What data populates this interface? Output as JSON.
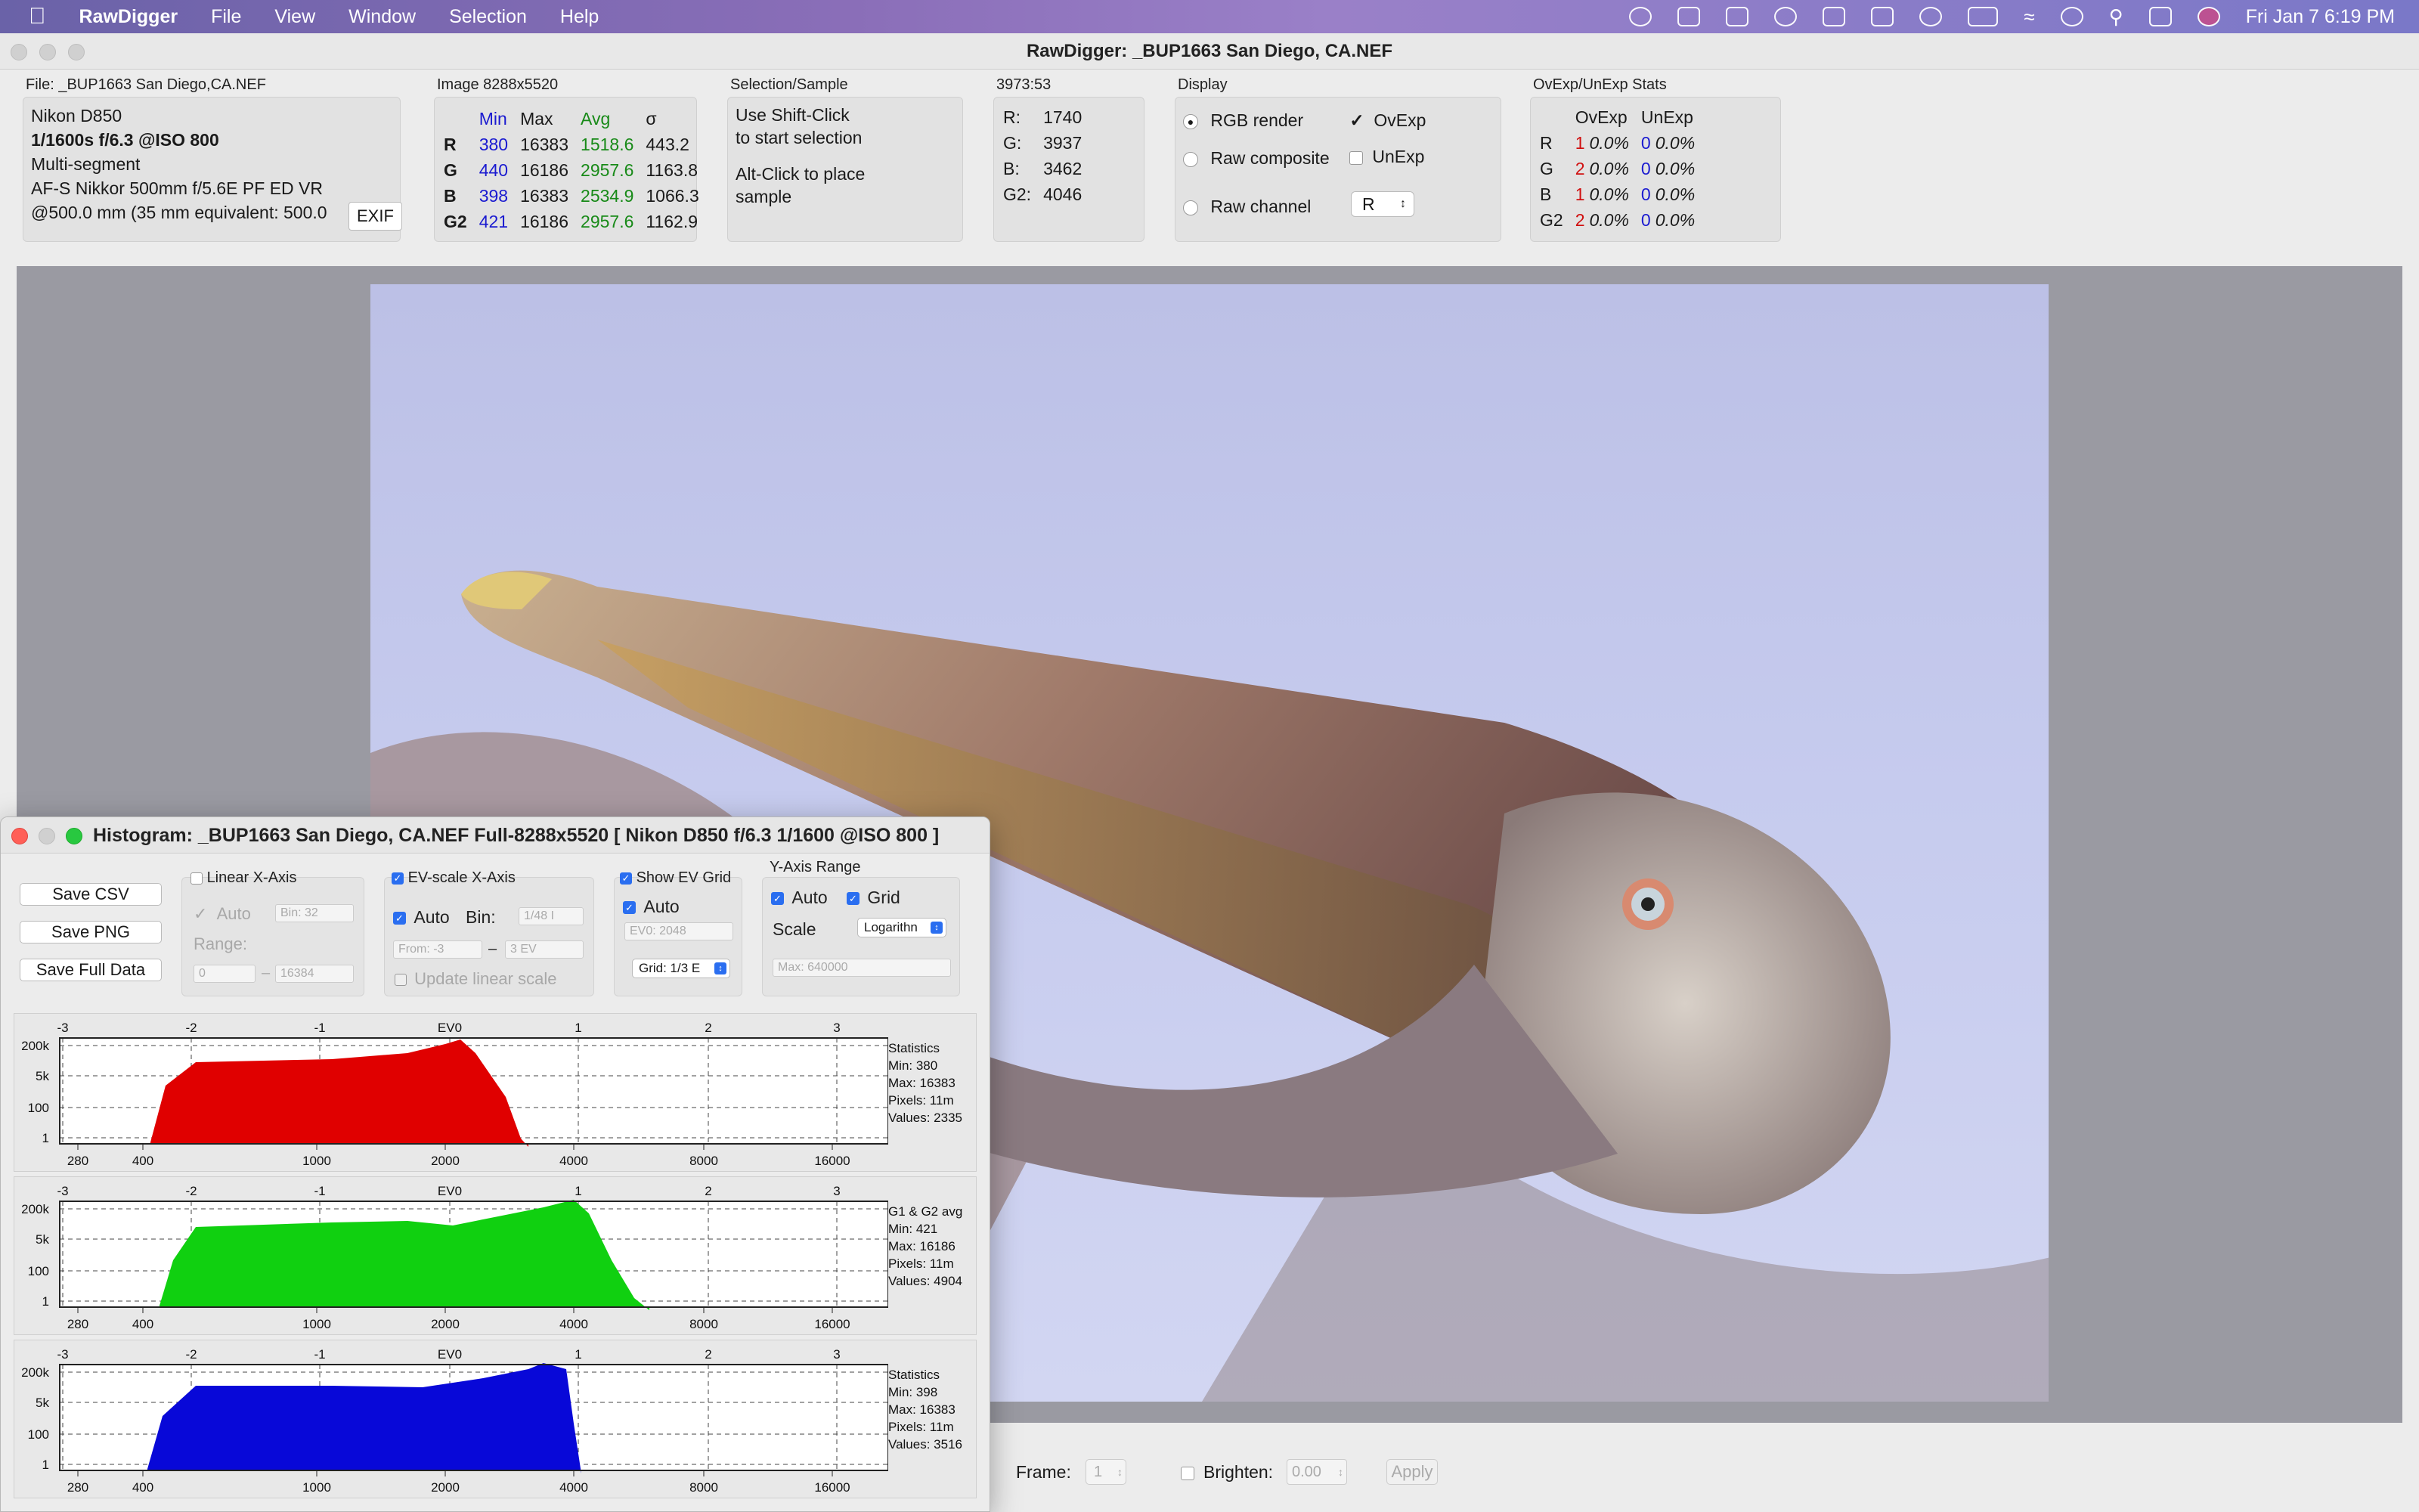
{
  "menubar": {
    "app_name": "RawDigger",
    "items": [
      "File",
      "View",
      "Window",
      "Selection",
      "Help"
    ],
    "clock": "Fri Jan 7  6:19 PM"
  },
  "window": {
    "title": "RawDigger: _BUP1663  San Diego, CA.NEF"
  },
  "file_panel": {
    "title": "File: _BUP1663  San Diego,CA.NEF",
    "camera": "Nikon D850",
    "exposure": "1/1600s f/6.3 @ISO 800",
    "mode": "Multi-segment",
    "lens": "AF-S Nikkor 500mm f/5.6E PF ED VR",
    "focal": "@500.0 mm (35 mm equivalent: 500.0",
    "exif_button": "EXIF"
  },
  "image_panel": {
    "title": "Image 8288x5520",
    "headers": [
      "",
      "Min",
      "Max",
      "Avg",
      "σ"
    ],
    "rows": [
      [
        "R",
        "380",
        "16383",
        "1518.6",
        "443.2"
      ],
      [
        "G",
        "440",
        "16186",
        "2957.6",
        "1163.8"
      ],
      [
        "B",
        "398",
        "16383",
        "2534.9",
        "1066.3"
      ],
      [
        "G2",
        "421",
        "16186",
        "2957.6",
        "1162.9"
      ]
    ]
  },
  "selection_panel": {
    "title": "Selection/Sample",
    "line1": "Use Shift-Click",
    "line2": "to start selection",
    "line3": "Alt-Click to place",
    "line4": "sample"
  },
  "coord_panel": {
    "title": "3973:53",
    "rows": [
      [
        "R:",
        "1740"
      ],
      [
        "G:",
        "3937"
      ],
      [
        "B:",
        "3462"
      ],
      [
        "G2:",
        "4046"
      ]
    ]
  },
  "display_panel": {
    "title": "Display",
    "rgb_render": "RGB render",
    "raw_composite": "Raw composite",
    "raw_channel": "Raw channel",
    "ovexp": "OvExp",
    "unexp": "UnExp",
    "channel_value": "R"
  },
  "stats_panel": {
    "title": "OvExp/UnExp Stats",
    "headers": [
      "",
      "OvExp",
      "",
      "UnExp",
      ""
    ],
    "rows": [
      [
        "R",
        "1",
        "0.0%",
        "0",
        "0.0%"
      ],
      [
        "G",
        "2",
        "0.0%",
        "0",
        "0.0%"
      ],
      [
        "B",
        "1",
        "0.0%",
        "0",
        "0.0%"
      ],
      [
        "G2",
        "2",
        "0.0%",
        "0",
        "0.0%"
      ]
    ]
  },
  "bottom_bar": {
    "frame_label": "Frame:",
    "frame_value": "1",
    "brighten_label": "Brighten:",
    "brighten_value": "0.00",
    "apply_label": "Apply"
  },
  "histogram": {
    "title": "Histogram: _BUP1663  San Diego, CA.NEF Full-8288x5520 [ Nikon D850 f/6.3 1/1600 @ISO 800 ]",
    "buttons": [
      "Save CSV",
      "Save PNG",
      "Save Full Data"
    ],
    "linear_x": {
      "title": "Linear X-Axis",
      "auto": "Auto",
      "bin": "Bin: 32",
      "range": "Range:",
      "from": "0",
      "to": "16384"
    },
    "ev_x": {
      "title": "EV-scale X-Axis",
      "auto": "Auto",
      "bin_label": "Bin:",
      "bin": "1/48 I",
      "from": "From: -3",
      "to": "3 EV",
      "update": "Update linear scale"
    },
    "ev_grid": {
      "title": "Show EV Grid",
      "auto": "Auto",
      "ev0": "EV0: 2048",
      "grid": "Grid: 1/3 E"
    },
    "y_range": {
      "title": "Y-Axis Range",
      "auto": "Auto",
      "grid": "Grid",
      "scale_label": "Scale",
      "scale": "Logarithn",
      "max": "Max: 640000"
    },
    "ev_ticks": [
      "-3",
      "-2",
      "-1",
      "EV0",
      "1",
      "2",
      "3"
    ],
    "y_ticks": [
      "200k",
      "5k",
      "100",
      "1"
    ],
    "x_ticks": [
      "280",
      "400",
      "1000",
      "2000",
      "4000",
      "8000",
      "16000"
    ],
    "channels": [
      {
        "color": "#e00000",
        "stats": [
          "Statistics",
          "Min: 380",
          "Max: 16383",
          "Pixels: 11m",
          "Values: 2335"
        ]
      },
      {
        "color": "#10d010",
        "stats": [
          "G1 & G2 avg",
          "Min: 421",
          "Max: 16186",
          "Pixels: 11m",
          "Values: 4904"
        ]
      },
      {
        "color": "#0808d8",
        "stats": [
          "Statistics",
          "Min: 398",
          "Max: 16383",
          "Pixels: 11m",
          "Values: 3516"
        ]
      }
    ]
  }
}
